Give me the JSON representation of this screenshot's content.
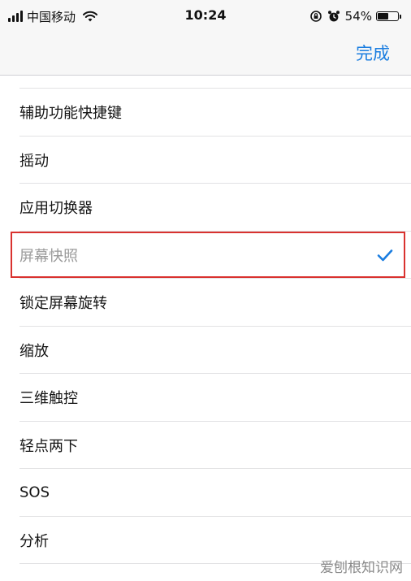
{
  "status_bar": {
    "carrier": "中国移动",
    "time": "10:24",
    "battery_percent": "54%",
    "battery_level": 0.54,
    "icons": [
      "signal-icon",
      "wifi-icon",
      "orientation-lock-icon",
      "alarm-icon",
      "battery-icon"
    ]
  },
  "nav": {
    "done_label": "完成"
  },
  "list": {
    "items": [
      {
        "label": "辅助功能快捷键",
        "checked": false
      },
      {
        "label": "摇动",
        "checked": false
      },
      {
        "label": "应用切换器",
        "checked": false
      },
      {
        "label": "屏幕快照",
        "checked": true
      },
      {
        "label": "锁定屏幕旋转",
        "checked": false
      },
      {
        "label": "缩放",
        "checked": false
      },
      {
        "label": "三维触控",
        "checked": false
      },
      {
        "label": "轻点两下",
        "checked": false
      },
      {
        "label": "SOS",
        "checked": false
      },
      {
        "label": "分析",
        "checked": false
      }
    ]
  },
  "colors": {
    "accent": "#1a7de0",
    "highlight": "#d9322f",
    "selected_text": "#9a9a9a"
  },
  "watermark": "爱刨根知识网"
}
